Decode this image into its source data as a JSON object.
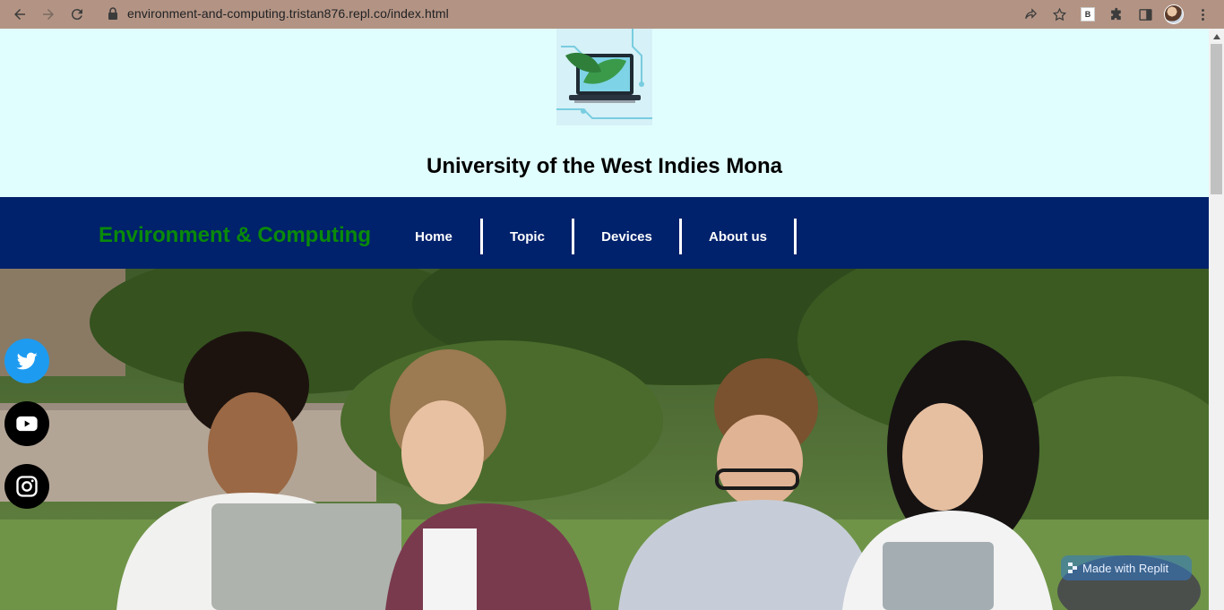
{
  "browser": {
    "url": "environment-and-computing.tristan876.repl.co/index.html",
    "extension_letter": "B"
  },
  "header": {
    "title": "University of the West Indies Mona"
  },
  "navbar": {
    "brand": "Environment & Computing",
    "items": [
      {
        "label": "Home"
      },
      {
        "label": "Topic"
      },
      {
        "label": "Devices"
      },
      {
        "label": "About us"
      }
    ]
  },
  "social": [
    {
      "icon": "twitter-icon",
      "color": "#1d9bf0"
    },
    {
      "icon": "youtube-icon",
      "color": "#000000"
    },
    {
      "icon": "instagram-icon",
      "color": "#000000"
    }
  ],
  "badge": {
    "label": "Made with Replit"
  },
  "colors": {
    "header_bg": "#e1fefe",
    "nav_bg": "#00216b",
    "brand_text": "#0a8a0a",
    "chrome": "#b39484"
  }
}
